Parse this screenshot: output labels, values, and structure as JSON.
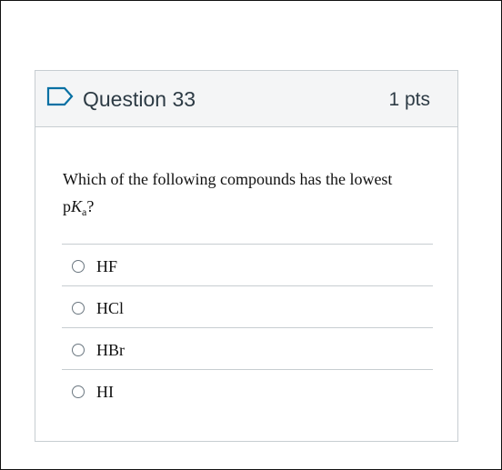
{
  "question": {
    "title": "Question 33",
    "points": "1 pts",
    "flag_icon": "bookmark-flag-icon",
    "text_prefix": "Which of the following compounds has the lowest",
    "text_p": "p",
    "text_K": "K",
    "text_sub": "a",
    "text_suffix": "?"
  },
  "answers": [
    {
      "label": "HF"
    },
    {
      "label": "HCl"
    },
    {
      "label": "HBr"
    },
    {
      "label": "HI"
    }
  ],
  "colors": {
    "header_bg": "#f4f5f6",
    "border": "#c7cdd1",
    "text": "#2d3b45",
    "flag": "#0770a3"
  }
}
